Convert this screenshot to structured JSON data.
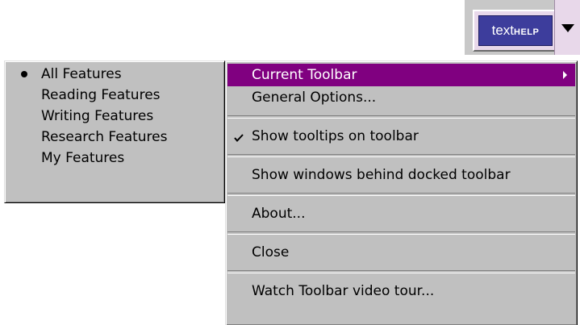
{
  "toolbar": {
    "brand_prefix": "text",
    "brand_suffix": "HELP",
    "dropdown_icon": "triangle-down-icon"
  },
  "submenu": {
    "items": [
      {
        "label": "All Features",
        "selected": true
      },
      {
        "label": "Reading Features",
        "selected": false
      },
      {
        "label": "Writing Features",
        "selected": false
      },
      {
        "label": "Research Features",
        "selected": false
      },
      {
        "label": "My Features",
        "selected": false
      }
    ]
  },
  "main_menu": {
    "items": [
      {
        "label": "Current Toolbar",
        "highlighted": true,
        "has_submenu": true
      },
      {
        "label": "General Options..."
      },
      {
        "label": "Show tooltips on toolbar",
        "checked": true
      },
      {
        "label": "Show windows behind docked toolbar"
      },
      {
        "label": "About..."
      },
      {
        "label": "Close"
      },
      {
        "label": "Watch Toolbar video tour..."
      }
    ]
  },
  "colors": {
    "menu_bg": "#c0c0c0",
    "highlight": "#800080",
    "brand_bg": "#3d3d9c",
    "toolbar_bg": "#e8d8ea"
  }
}
